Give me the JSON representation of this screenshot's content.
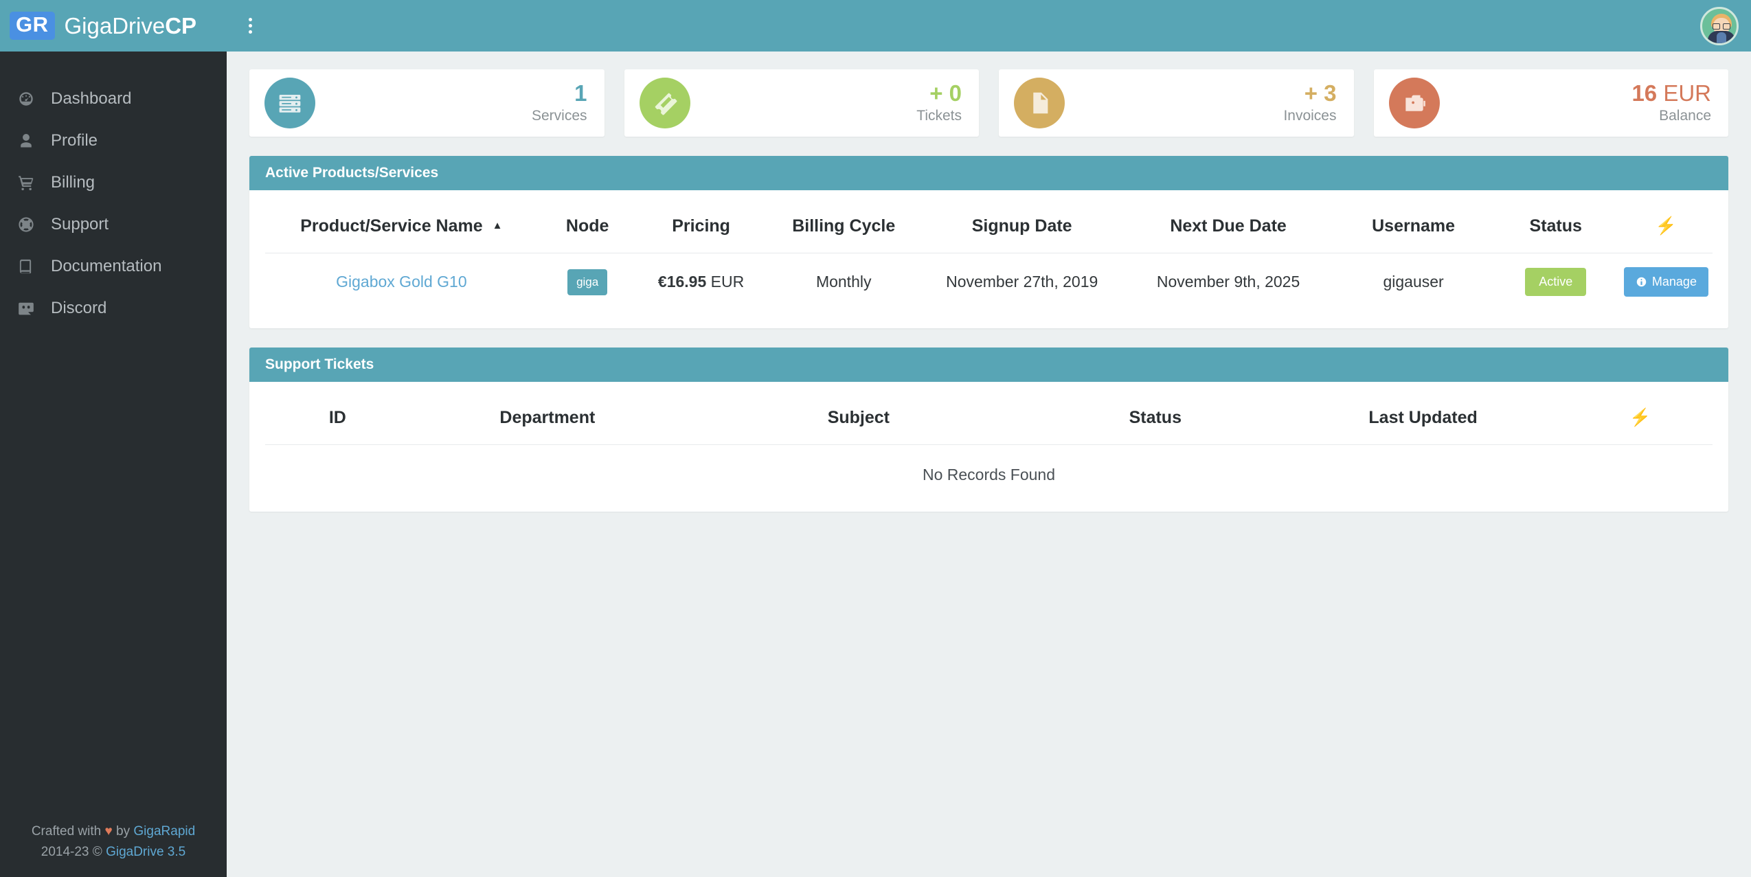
{
  "brand": {
    "badge": "GR",
    "name_light": "GigaDrive",
    "name_bold": "CP"
  },
  "topbar": {
    "menu_icon": "kebab-menu-icon",
    "avatar_alt": "user-avatar"
  },
  "sidebar": {
    "items": [
      {
        "label": "Dashboard",
        "icon": "tachometer-icon"
      },
      {
        "label": "Profile",
        "icon": "user-icon"
      },
      {
        "label": "Billing",
        "icon": "shopping-cart-icon"
      },
      {
        "label": "Support",
        "icon": "life-ring-icon"
      },
      {
        "label": "Documentation",
        "icon": "book-icon"
      },
      {
        "label": "Discord",
        "icon": "discord-icon"
      }
    ],
    "footer": {
      "crafted_prefix": "Crafted with ",
      "heart": "♥",
      "crafted_by": " by ",
      "crafted_link": "GigaRapid",
      "copyright": "2014-23 © ",
      "copyright_link": "GigaDrive 3.5"
    }
  },
  "stats": [
    {
      "value": "1",
      "currency": "",
      "label": "Services",
      "icon": "server-icon",
      "color": "#58a5b5",
      "bg": "#58a5b5"
    },
    {
      "value": "+ 0",
      "currency": "",
      "label": "Tickets",
      "icon": "ticket-icon",
      "color": "#a5d063",
      "bg": "#a5d063"
    },
    {
      "value": "+ 3",
      "currency": "",
      "label": "Invoices",
      "icon": "file-icon",
      "color": "#d4ae61",
      "bg": "#d4ae61"
    },
    {
      "value": "16",
      "currency": " EUR",
      "label": "Balance",
      "icon": "wallet-icon",
      "color": "#d4795a",
      "bg": "#d4795a"
    }
  ],
  "products_panel": {
    "title": "Active Products/Services",
    "columns": [
      "Product/Service Name",
      "Node",
      "Pricing",
      "Billing Cycle",
      "Signup Date",
      "Next Due Date",
      "Username",
      "Status",
      "⚡"
    ],
    "sort_indicator": "▲",
    "rows": [
      {
        "name": "Gigabox Gold G10",
        "node": "giga",
        "price_amount": "€16.95",
        "price_currency": " EUR",
        "billing_cycle": "Monthly",
        "signup_date": "November 27th, 2019",
        "next_due_date": "November 9th, 2025",
        "username": "gigauser",
        "status": "Active",
        "action": "Manage"
      }
    ]
  },
  "tickets_panel": {
    "title": "Support Tickets",
    "columns": [
      "ID",
      "Department",
      "Subject",
      "Status",
      "Last Updated",
      "⚡"
    ],
    "empty_message": "No Records Found"
  }
}
